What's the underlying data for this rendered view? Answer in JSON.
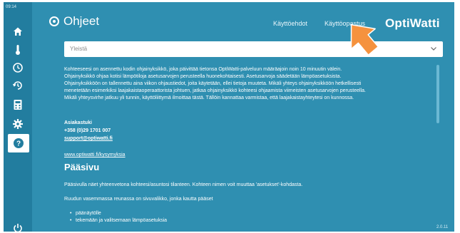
{
  "status": {
    "time": "09:14"
  },
  "sidebar": {
    "items": [
      {
        "icon": "home-icon"
      },
      {
        "icon": "thermometer-icon"
      },
      {
        "icon": "schedule-icon"
      },
      {
        "icon": "history-icon"
      },
      {
        "icon": "calculator-icon"
      },
      {
        "icon": "gear-icon"
      },
      {
        "icon": "help-icon",
        "active": true
      },
      {
        "icon": "power-icon"
      }
    ]
  },
  "header": {
    "title": "Ohjeet",
    "links": [
      "Käyttöehdot",
      "Käyttöopastus"
    ],
    "brand": "OptiWatti"
  },
  "dropdown": {
    "value": "Yleistä"
  },
  "content": {
    "intro_lines": [
      "Kohteeseesi on asennettu kodin ohjainyksikkö, joka päivittää tietonsa OptiWatti-palveluun määräajoin noin 10 minuutin välein.",
      "Ohjainyksikkö ohjaa kotisi lämpötiloja asetusarvojen perusteella huonekohtaisesti. Asetusarvoja säädetään lämpöasetuksista.",
      "Ohjainyksikköön on tallennettu aina viikon ohjaustiedot, joita käytetään, ellei tietoja muuteta. Mikäli yhteys ohjainyksikköön hetkellisesti",
      "menetetään esimerkiksi laajakaistaoperaattorista johtuen, jatkaa ohjainyksikkö kohteesi ohjaamista viimeisten asetusarvojen perusteella.",
      "Mikäli yhteysvirhe jatkuu yli tunnin, käyttöliittymä ilmoittaa tästä. Tällöin kannattaa varmistaa, että laajakaistayhteytesi on kunnossa."
    ],
    "contact_title": "Asiakastuki",
    "contact_phone": "+358 (0)29 1701 007",
    "contact_email": "support@optiwatti.fi",
    "faq_link": "www.optiwatti.fi/kysymyksia",
    "section_title": "Pääsivu",
    "section_p1": "Pääsivulla näet yhteenvetona kohteesi/asuntosi tilanteen. Kohteen nimen voit muuttaa 'asetukset'-kohdasta.",
    "section_p2": "Ruudun vasemmassa reunassa on sivuvalikko, jonka kautta pääset",
    "bullets": [
      "päänäytölle",
      "tekemään ja valitsemaan lämpöasetuksia"
    ]
  },
  "version": "2.0.11",
  "colors": {
    "background": "#2f8fb1",
    "sidebar": "#227d9f",
    "arrow": "#f5923e"
  }
}
